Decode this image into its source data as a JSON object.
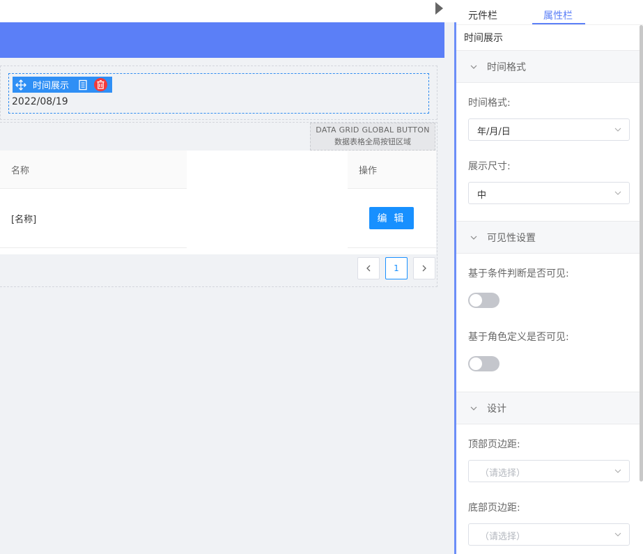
{
  "canvas": {
    "time_component": {
      "toolbar_label": "时间展示",
      "value": "2022/08/19"
    },
    "data_grid": {
      "global_button_en": "DATA GRID GLOBAL BUTTON",
      "global_button_zh": "数据表格全局按钮区域",
      "columns": [
        "名称",
        "操作"
      ],
      "rows": [
        {
          "name": "[名称]",
          "action": "编 辑"
        }
      ],
      "pagination": {
        "prev": "<",
        "current": "1",
        "next": ">"
      }
    }
  },
  "panel": {
    "tabs": [
      "元件栏",
      "属性栏"
    ],
    "active_tab": "属性栏",
    "title": "时间展示",
    "sections": [
      {
        "label": "时间格式"
      },
      {
        "label": "可见性设置"
      },
      {
        "label": "设计"
      }
    ],
    "fields": {
      "time_format_label": "时间格式:",
      "time_format_value": "年/月/日",
      "display_size_label": "展示尺寸:",
      "display_size_value": "中",
      "cond_visible_label": "基于条件判断是否可见:",
      "cond_visible_on": false,
      "role_visible_label": "基于角色定义是否可见:",
      "role_visible_on": false,
      "top_margin_label": "顶部页边距:",
      "top_margin_placeholder": "（请选择）",
      "bottom_margin_label": "底部页边距:",
      "bottom_margin_placeholder": "（请选择）"
    }
  },
  "colors": {
    "header_blue": "#5b7ff7",
    "primary": "#1890ff",
    "delete_red": "#f23a3a"
  },
  "icons": [
    "play-arrow-icon",
    "move-icon",
    "copy-icon",
    "trash-icon",
    "chevron-down-icon",
    "chevron-left-icon",
    "chevron-right-icon"
  ]
}
